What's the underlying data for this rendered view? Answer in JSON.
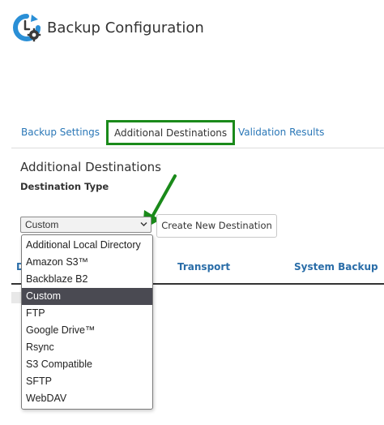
{
  "header": {
    "title": "Backup Configuration",
    "logo_icon": "backup-clock-gear-icon"
  },
  "tabs": [
    {
      "label": "Backup Settings",
      "active": false
    },
    {
      "label": "Additional Destinations",
      "active": true
    },
    {
      "label": "Validation Results",
      "active": false
    }
  ],
  "section": {
    "heading": "Additional Destinations",
    "destination_type_label": "Destination Type"
  },
  "destination_select": {
    "value": "Custom",
    "options": [
      "Additional Local Directory",
      "Amazon S3™",
      "Backblaze B2",
      "Custom",
      "FTP",
      "Google Drive™",
      "Rsync",
      "S3 Compatible",
      "SFTP",
      "WebDAV"
    ]
  },
  "create_button": {
    "label": "Create New Destination"
  },
  "table": {
    "headers": [
      "D",
      "Transport",
      "System Backup"
    ]
  },
  "colors": {
    "link": "#2a77b7",
    "highlight_border": "#1a8a1a",
    "arrow": "#1a8a1a",
    "selected_option_bg": "#4a4a52",
    "logo_blue": "#2a8fd6"
  }
}
